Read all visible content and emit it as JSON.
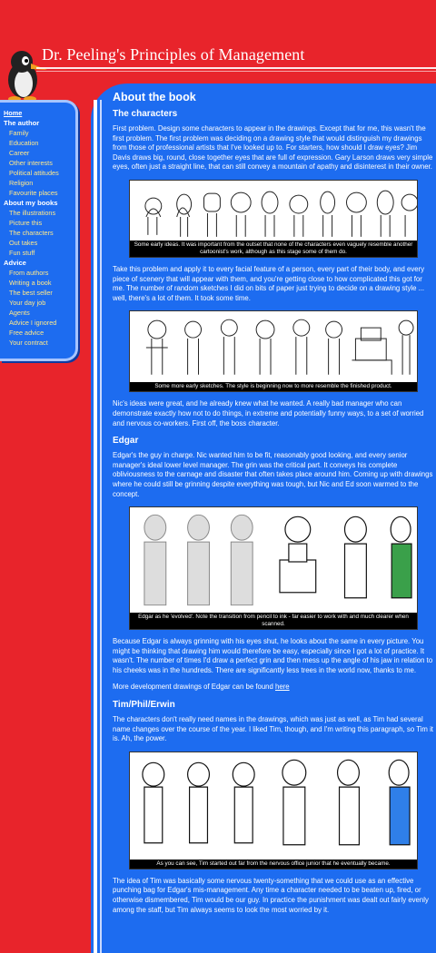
{
  "site": {
    "title": "Dr. Peeling's Principles of Management"
  },
  "sidebar": {
    "items": [
      {
        "label": "Home",
        "kind": "home"
      },
      {
        "label": "The author",
        "kind": "section"
      },
      {
        "label": "Family",
        "kind": "sub"
      },
      {
        "label": "Education",
        "kind": "sub"
      },
      {
        "label": "Career",
        "kind": "sub"
      },
      {
        "label": "Other interests",
        "kind": "sub"
      },
      {
        "label": "Political attitudes",
        "kind": "sub"
      },
      {
        "label": "Religion",
        "kind": "sub"
      },
      {
        "label": "Favourite places",
        "kind": "sub"
      },
      {
        "label": "About my books",
        "kind": "section"
      },
      {
        "label": "The illustrations",
        "kind": "sub"
      },
      {
        "label": "Picture this",
        "kind": "sub"
      },
      {
        "label": "The characters",
        "kind": "sub"
      },
      {
        "label": "Out takes",
        "kind": "sub"
      },
      {
        "label": "Fun stuff",
        "kind": "sub"
      },
      {
        "label": "Advice",
        "kind": "section"
      },
      {
        "label": "From authors",
        "kind": "sub"
      },
      {
        "label": "Writing a book",
        "kind": "sub"
      },
      {
        "label": "The best seller",
        "kind": "sub"
      },
      {
        "label": "Your day job",
        "kind": "sub"
      },
      {
        "label": "Agents",
        "kind": "sub"
      },
      {
        "label": "Advice I ignored",
        "kind": "sub"
      },
      {
        "label": "Free advice",
        "kind": "sub"
      },
      {
        "label": "Your contract",
        "kind": "sub"
      }
    ]
  },
  "main": {
    "page_title": "About the book",
    "characters_heading": "The characters",
    "p1": "First problem. Design some characters to appear in the drawings. Except that for me, this wasn't the first problem. The first problem was deciding on a drawing style that would distinguish my drawings from those of professional artists that I've looked up to. For starters, how should I draw eyes? Jim Davis draws big, round, close together eyes that are full of expression. Gary Larson draws very simple eyes, often just a straight line, that can still convey a mountain of apathy and disinterest in their owner.",
    "fig1_caption": "Some early ideas. It was important from the outset that none of the characters even vaguely resemble another cartoonist's work, although as this stage some of them do.",
    "p2": "Take this problem and apply it to every facial feature of a person, every part of their body, and every piece of scenery that will appear with them, and you're getting close to how complicated this got for me. The number of random sketches I did on bits of paper just trying to decide on a drawing style ... well, there's a lot of them. It took some time.",
    "fig2_caption": "Some more early sketches. The style is beginning now to more resemble the finished product.",
    "p3": "Nic's ideas were great, and he already knew what he wanted. A really bad manager who can demonstrate exactly how not to do things, in extreme and potentially funny ways, to a set of worried and nervous co-workers. First off, the boss character.",
    "edgar_heading": "Edgar",
    "p4": "Edgar's the guy in charge. Nic wanted him to be fit, reasonably good looking, and every senior manager's ideal lower level manager. The grin was the critical part. It conveys his complete obliviousness to the carnage and disaster that often takes place around him. Coming up with drawings where he could still be grinning despite everything was tough, but Nic and Ed soon warmed to the concept.",
    "fig3_caption": "Edgar as he 'evolved'. Note the transition from pencil to ink - far easier to work with and much clearer when scanned.",
    "p5": "Because Edgar is always grinning with his eyes shut, he looks about the same in every picture. You might be thinking that drawing him would therefore be easy, especially since I got a lot of practice. It wasn't. The number of times I'd draw a perfect grin and then mess up the angle of his jaw in relation to his cheeks was in the hundreds. There are significantly less trees in the world now, thanks to me.",
    "p6_prefix": "More development drawings of Edgar can be found ",
    "p6_link": "here",
    "tim_heading": "Tim/Phil/Erwin",
    "p7": "The characters don't really need names in the drawings, which was just as well, as Tim had several name changes over the course of the year. I liked Tim, though, and I'm writing this paragraph, so Tim it is. Ah, the power.",
    "fig4_caption": "As you can see, Tim started out far from the nervous office junior that he eventually became.",
    "p8": "The idea of Tim was basically some nervous twenty-something that we could use as an effective punching bag for Edgar's mis-management. Any time a character needed to be beaten up, fired, or otherwise dismembered, Tim would be our guy. In practice the punishment was dealt out fairly evenly among the staff, but Tim always seems to look the most worried by it."
  },
  "colors": {
    "background_red": "#e8242b",
    "content_blue": "#1d6cf0",
    "sidebar_link": "#ffe98a"
  }
}
